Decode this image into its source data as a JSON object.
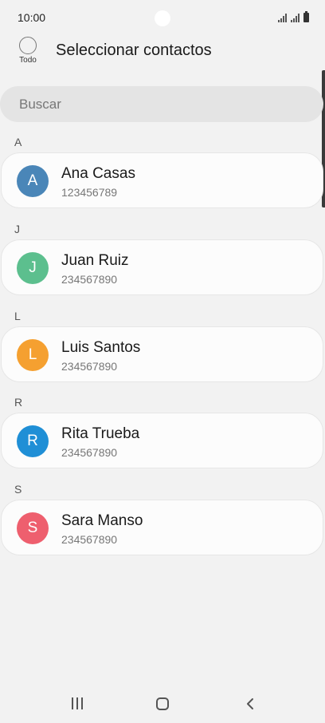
{
  "status_bar": {
    "time": "10:00",
    "icons": [
      "signal-icon",
      "signal-icon",
      "battery-icon"
    ]
  },
  "header": {
    "select_all_label": "Todo",
    "title": "Seleccionar contactos"
  },
  "search": {
    "placeholder": "Buscar"
  },
  "sections": [
    {
      "letter": "A",
      "contact": {
        "initial": "A",
        "name": "Ana Casas",
        "phone": "123456789",
        "color": "#4a86b8"
      }
    },
    {
      "letter": "J",
      "contact": {
        "initial": "J",
        "name": "Juan Ruiz",
        "phone": "234567890",
        "color": "#5cbf8e"
      }
    },
    {
      "letter": "L",
      "contact": {
        "initial": "L",
        "name": "Luis Santos",
        "phone": "234567890",
        "color": "#f5a030"
      }
    },
    {
      "letter": "R",
      "contact": {
        "initial": "R",
        "name": "Rita Trueba",
        "phone": "234567890",
        "color": "#1f8fd6"
      }
    },
    {
      "letter": "S",
      "contact": {
        "initial": "S",
        "name": "Sara Manso",
        "phone": "234567890",
        "color": "#ee5f6e"
      }
    }
  ],
  "nav_bar": {
    "icons": [
      "recent-apps-icon",
      "home-icon",
      "back-icon"
    ]
  }
}
